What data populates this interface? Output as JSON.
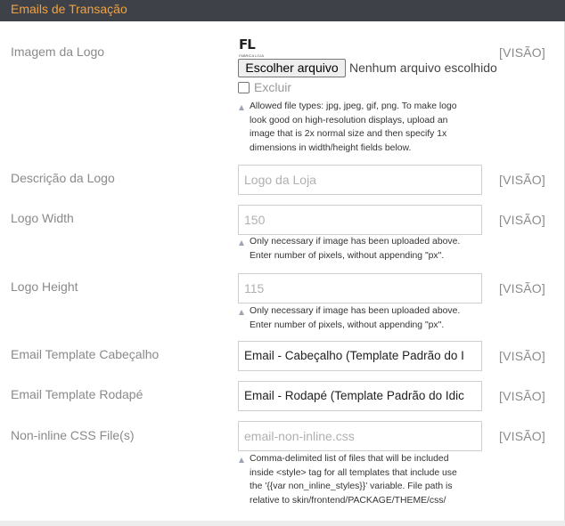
{
  "section": {
    "title": "Emails de Transação"
  },
  "logo_image": {
    "label": "Imagem da Logo",
    "choose_button": "Escolher arquivo",
    "file_status": "Nenhum arquivo escolhido",
    "delete_label": "Excluir",
    "note_lines": [
      "Allowed file types: jpg, jpeg, gif, png. To make logo",
      "look good on high-resolution displays, upload an",
      "image that is 2x normal size and then specify 1x",
      "dimensions in width/height fields below."
    ],
    "scope": "[VISÃO]"
  },
  "logo_alt": {
    "label": "Descrição da Logo",
    "placeholder": "Logo da Loja",
    "scope": "[VISÃO]"
  },
  "logo_width": {
    "label": "Logo Width",
    "placeholder": "150",
    "note_lines": [
      "Only necessary if image has been uploaded above.",
      "Enter number of pixels, without appending \"px\"."
    ],
    "scope": "[VISÃO]"
  },
  "logo_height": {
    "label": "Logo Height",
    "placeholder": "115",
    "note_lines": [
      "Only necessary if image has been uploaded above.",
      "Enter number of pixels, without appending \"px\"."
    ],
    "scope": "[VISÃO]"
  },
  "header_template": {
    "label": "Email Template Cabeçalho",
    "value": "Email - Cabeçalho (Template Padrão do I",
    "scope": "[VISÃO]"
  },
  "footer_template": {
    "label": "Email Template Rodapé",
    "value": "Email - Rodapé (Template Padrão do Idic",
    "scope": "[VISÃO]"
  },
  "css_file": {
    "label": "Non-inline CSS File(s)",
    "placeholder": "email-non-inline.css",
    "note_lines": [
      "Comma-delimited list of files that will be included",
      "inside <style> tag for all templates that include use",
      "the '{{var non_inline_styles}}' variable. File path is",
      "relative to skin/frontend/PACKAGE/THEME/css/"
    ],
    "scope": "[VISÃO]"
  }
}
